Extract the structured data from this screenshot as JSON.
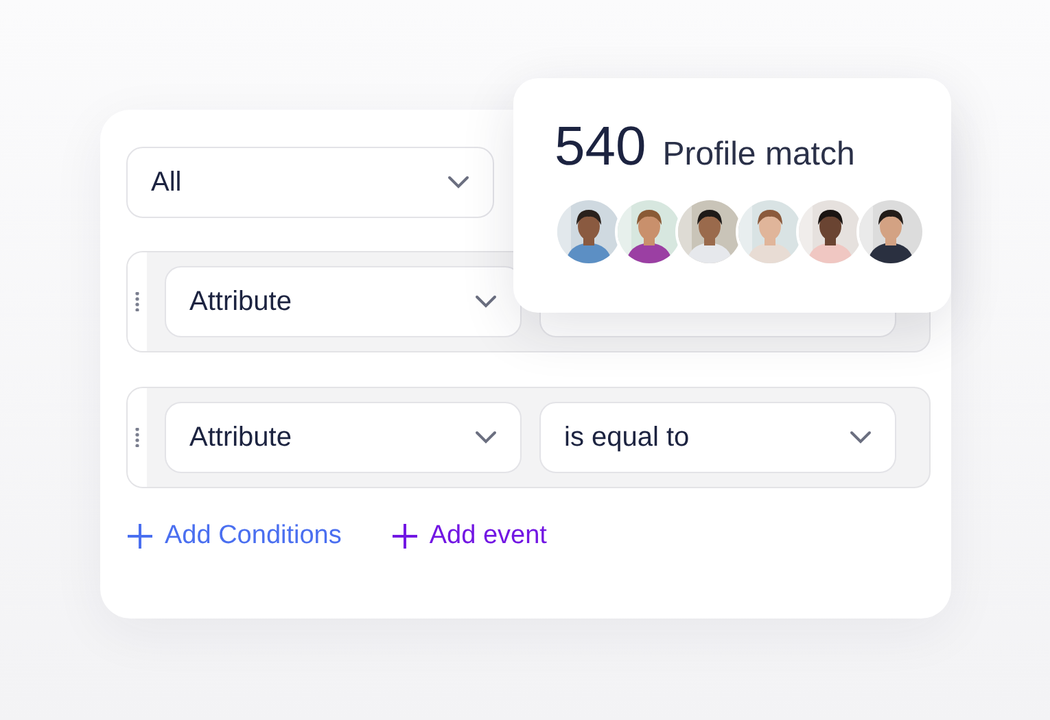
{
  "match_filter": {
    "value": "All"
  },
  "conditions": [
    {
      "attribute": "Attribute"
    },
    {
      "attribute": "Attribute",
      "operator": "is equal to"
    }
  ],
  "actions": [
    {
      "label": "Add Conditions",
      "kind": "condition"
    },
    {
      "label": "Add event",
      "kind": "event"
    }
  ],
  "match_popup": {
    "count": "540",
    "label": "Profile match"
  }
}
